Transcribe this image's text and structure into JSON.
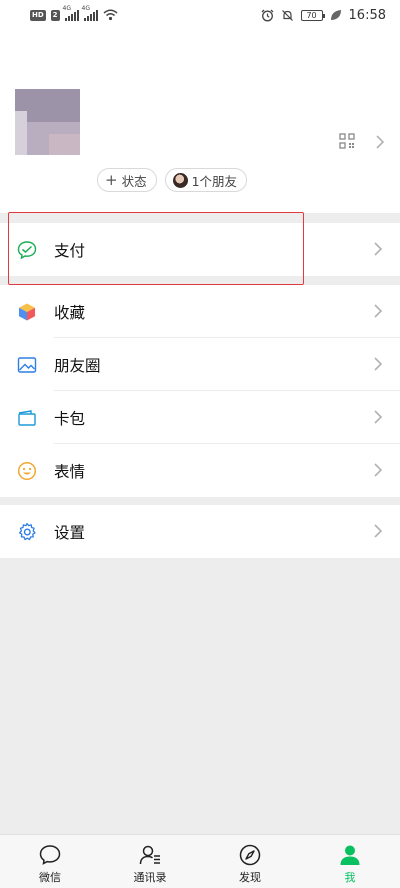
{
  "status_bar": {
    "left_badges": [
      "HD",
      "2",
      "4G",
      "4G"
    ],
    "battery": "70",
    "time": "16:58"
  },
  "profile": {
    "name": "",
    "wechat_id": "",
    "status_label": "状态",
    "friends_label": "1个朋友"
  },
  "menu": {
    "pay": "支付",
    "favorites": "收藏",
    "moments": "朋友圈",
    "cards": "卡包",
    "stickers": "表情",
    "settings": "设置"
  },
  "tabs": {
    "chats": "微信",
    "contacts": "通讯录",
    "discover": "发现",
    "me": "我"
  },
  "colors": {
    "accent": "#07c160",
    "highlight": "#e4393c",
    "background": "#ededed"
  }
}
